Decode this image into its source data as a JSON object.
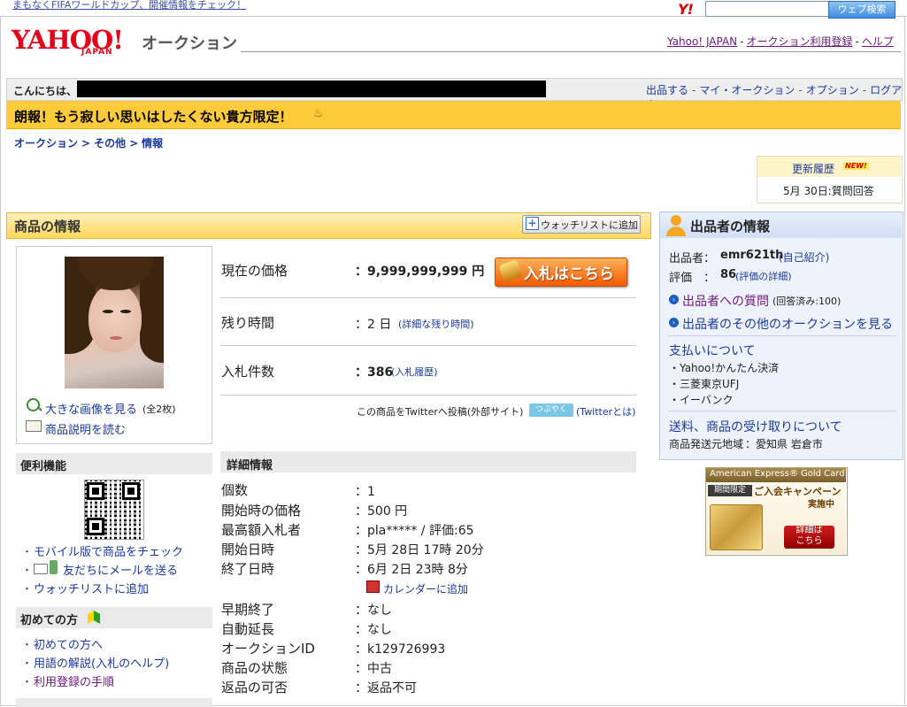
{
  "top": {
    "notice": "まもなくFIFAワールドカップ、開催情報をチェック！",
    "search_button": "ウェブ検索",
    "y_logo": "Y!"
  },
  "header": {
    "logo": "YAHOO!",
    "logo_sub": "JAPAN",
    "section": "オークション",
    "links": [
      "Yahoo! JAPAN",
      "オークション利用登録",
      "ヘルプ"
    ]
  },
  "hello": {
    "greeting": "こんにちは、",
    "links": [
      "出品する",
      "マイ・オークション",
      "オプション",
      "ログアウト"
    ]
  },
  "banner": {
    "text": "朗報！もう寂しい思いはしたくない貴方限定！"
  },
  "breadcrumb": [
    "オークション",
    "その他",
    "情報"
  ],
  "update": {
    "title": "更新履歴",
    "badge": "NEW!",
    "date": "5月 30日:質問回答"
  },
  "item": {
    "header_title": "商品の情報",
    "watch_button": "ウォッチリストに追加",
    "large_image_link": "大きな画像を見る",
    "large_image_count": "(全2枚)",
    "read_desc_link": "商品説明を読む",
    "price_label": "現在の価格",
    "price_value": "：9,999,999,999 円",
    "bid_button": "入札はこちら",
    "remaining_label": "残り時間",
    "remaining_value": "：2 日",
    "remaining_link": "(詳細な残り時間)",
    "bids_label": "入札件数",
    "bids_value": "：386",
    "bids_link": "(入札履歴)",
    "twitter_text": "この商品をTwitterへ投稿(外部サイト)",
    "twitter_button": "つぶやく",
    "twitter_link": "(Twitterとは)"
  },
  "details": {
    "title": "詳細情報",
    "rows": [
      {
        "label": "個数",
        "value": "：1"
      },
      {
        "label": "開始時の価格",
        "value": "：500 円"
      },
      {
        "label": "最高額入札者",
        "value": "：pla***** / 評価:65"
      },
      {
        "label": "開始日時",
        "value": "：5月 28日 17時 20分"
      },
      {
        "label": "終了日時",
        "value": "：6月 2日 23時 8分"
      },
      {
        "label": "早期終了",
        "value": "：なし"
      },
      {
        "label": "自動延長",
        "value": "：なし"
      },
      {
        "label": "オークションID",
        "value": "：k129726993"
      },
      {
        "label": "商品の状態",
        "value": "：中古"
      },
      {
        "label": "返品の可否",
        "value": "：返品不可"
      }
    ],
    "calendar_link": "カレンダーに追加"
  },
  "convenience": {
    "title": "便利機能",
    "links": [
      "モバイル版で商品をチェック",
      "友だちにメールを送る",
      "ウォッチリストに追加"
    ]
  },
  "first_time": {
    "title": "初めての方",
    "links": [
      "初めての方へ",
      "用語の解説(入札のヘルプ)",
      "利用登録の手順"
    ]
  },
  "seller": {
    "title": "出品者の情報",
    "seller_label": "出品者：",
    "seller_id": "emr621th",
    "self_intro": "(自己紹介)",
    "rating_label": "評価　：",
    "rating_value": "86",
    "rating_link": "(評価の詳細)",
    "question_link": "出品者への質問",
    "question_count": "(回答済み:100)",
    "other_auctions": "出品者のその他のオークションを見る",
    "payment_title": "支払いについて",
    "payment_methods": [
      "Yahoo!かんたん決済",
      "三菱東京UFJ",
      "イーバンク"
    ],
    "shipping_title": "送料、商品の受け取りについて",
    "ship_from_label": "商品発送元地域",
    "ship_from_value": "：愛知県 岩倉市"
  },
  "ad": {
    "header": "American Express® Gold Card",
    "tag": "期間限定",
    "campaign_line1": "ご入会キャンペーン",
    "campaign_line2": "実施中",
    "button_line1": "詳細は",
    "button_line2": "こちら"
  }
}
